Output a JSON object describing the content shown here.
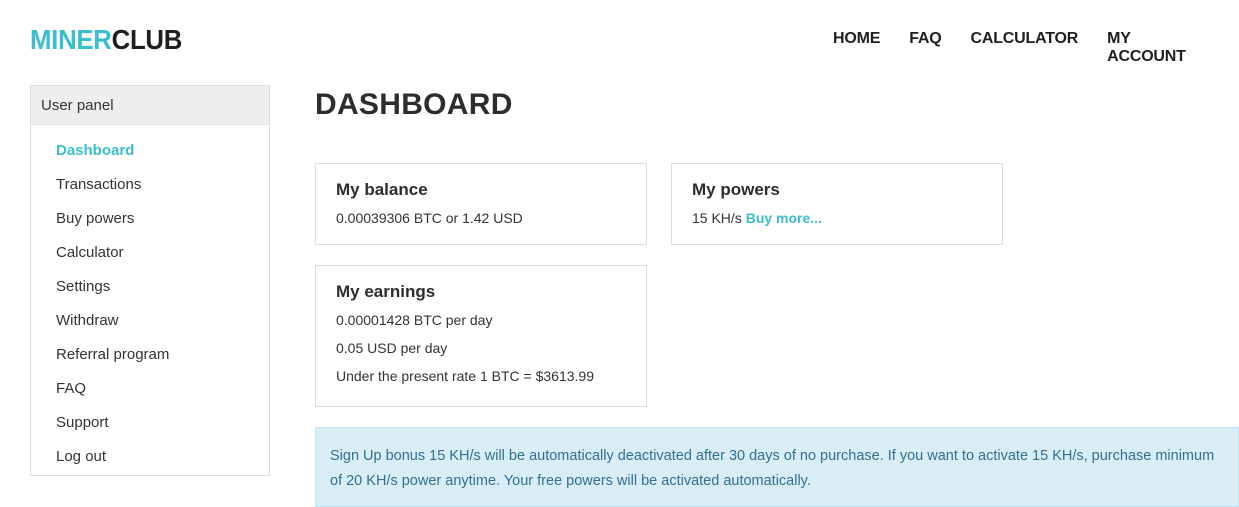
{
  "logo": {
    "part1": "MINER",
    "part2": "CLUB"
  },
  "nav": {
    "home": "HOME",
    "faq": "FAQ",
    "calculator": "CALCULATOR",
    "account": "MY ACCOUNT"
  },
  "sidebar": {
    "header": "User panel",
    "items": [
      {
        "label": "Dashboard",
        "active": true
      },
      {
        "label": "Transactions"
      },
      {
        "label": "Buy powers"
      },
      {
        "label": "Calculator"
      },
      {
        "label": "Settings"
      },
      {
        "label": "Withdraw"
      },
      {
        "label": "Referral program"
      },
      {
        "label": "FAQ"
      },
      {
        "label": "Support"
      },
      {
        "label": "Log out"
      }
    ]
  },
  "main": {
    "title": "DASHBOARD",
    "balance": {
      "title": "My balance",
      "text": "0.00039306 BTC or 1.42 USD"
    },
    "powers": {
      "title": "My powers",
      "value": "15 KH/s",
      "link": "Buy more..."
    },
    "earnings": {
      "title": "My earnings",
      "btc": "0.00001428 BTC per day",
      "usd": "0.05 USD per day",
      "rate": "Under the present rate 1 BTC = $3613.99"
    },
    "notice": "Sign Up bonus 15 KH/s will be automatically deactivated after 30 days of no purchase. If you want to activate 15 KH/s, purchase minimum of 20 KH/s power anytime. Your free powers will be activated automatically."
  },
  "colors": {
    "accent": "#3bbfcf",
    "notice_bg": "#d9edf7",
    "notice_text": "#31708f"
  }
}
